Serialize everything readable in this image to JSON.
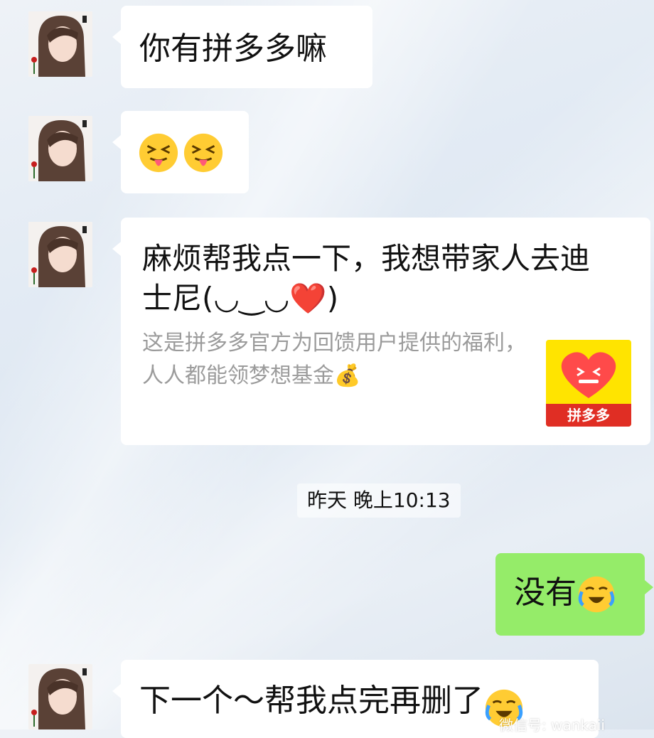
{
  "chat": {
    "messages": [
      {
        "text": "你有拼多多嘛"
      },
      {
        "text": ""
      },
      {
        "card": {
          "title": "麻烦帮我点一下，我想带家人去迪士尼(◡‿◡❤️)",
          "desc": "这是拼多多官方为回馈用户提供的福利，人人都能领梦想基金💰",
          "logo_label": "拼多多"
        }
      },
      {
        "timestamp": "昨天 晚上10:13"
      },
      {
        "text": "没有"
      },
      {
        "text": "下一个～帮我点完再删了"
      }
    ]
  },
  "watermark": "微信号: wankaii",
  "icons": {
    "tongue_face": "squinting-tongue-emoji",
    "cry_laugh": "crying-emoji",
    "money_bag": "money-bag-emoji",
    "heart": "red-heart-emoji"
  },
  "colors": {
    "my_bubble": "#95ec69",
    "other_bubble": "#ffffff",
    "pdd_red": "#e02e24",
    "pdd_yellow": "#ffe400"
  }
}
